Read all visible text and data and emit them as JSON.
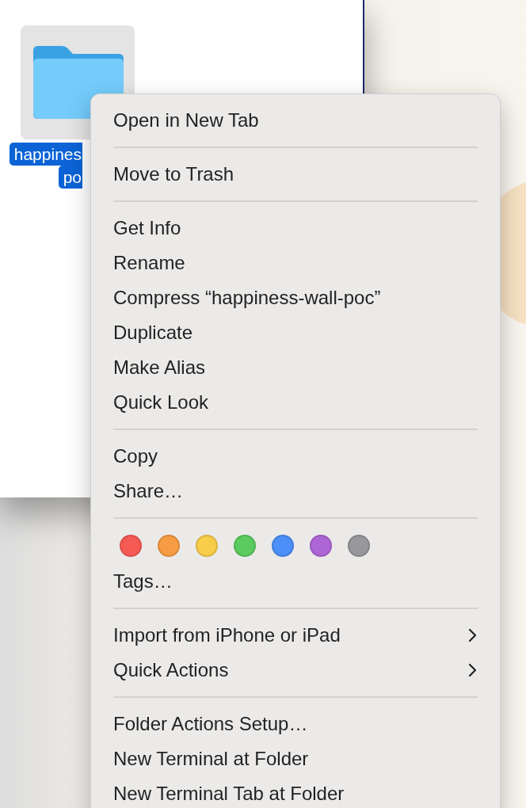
{
  "folder": {
    "label_lines": [
      "happines",
      "po"
    ],
    "selected": true
  },
  "context_menu": {
    "sections": [
      {
        "items": [
          {
            "kind": "item",
            "label": "Open in New Tab"
          }
        ]
      },
      {
        "items": [
          {
            "kind": "item",
            "label": "Move to Trash"
          }
        ]
      },
      {
        "items": [
          {
            "kind": "item",
            "label": "Get Info"
          },
          {
            "kind": "item",
            "label": "Rename"
          },
          {
            "kind": "item",
            "label": "Compress “happiness-wall-poc”"
          },
          {
            "kind": "item",
            "label": "Duplicate"
          },
          {
            "kind": "item",
            "label": "Make Alias"
          },
          {
            "kind": "item",
            "label": "Quick Look"
          }
        ]
      },
      {
        "items": [
          {
            "kind": "item",
            "label": "Copy"
          },
          {
            "kind": "item",
            "label": "Share…"
          }
        ]
      },
      {
        "items": [
          {
            "kind": "tags",
            "tags": [
              {
                "color": "#f65a55"
              },
              {
                "color": "#f69c42"
              },
              {
                "color": "#f8cd4a"
              },
              {
                "color": "#5ccb5f"
              },
              {
                "color": "#4c8ff8"
              },
              {
                "color": "#ae66d6"
              },
              {
                "color": "#98989c"
              }
            ]
          },
          {
            "kind": "item",
            "label": "Tags…"
          }
        ]
      },
      {
        "items": [
          {
            "kind": "submenu",
            "label": "Import from iPhone or iPad"
          },
          {
            "kind": "submenu",
            "label": "Quick Actions"
          }
        ]
      },
      {
        "items": [
          {
            "kind": "item",
            "label": "Folder Actions Setup…"
          },
          {
            "kind": "item",
            "label": "New Terminal at Folder"
          },
          {
            "kind": "item",
            "label": "New Terminal Tab at Folder"
          }
        ]
      }
    ]
  }
}
